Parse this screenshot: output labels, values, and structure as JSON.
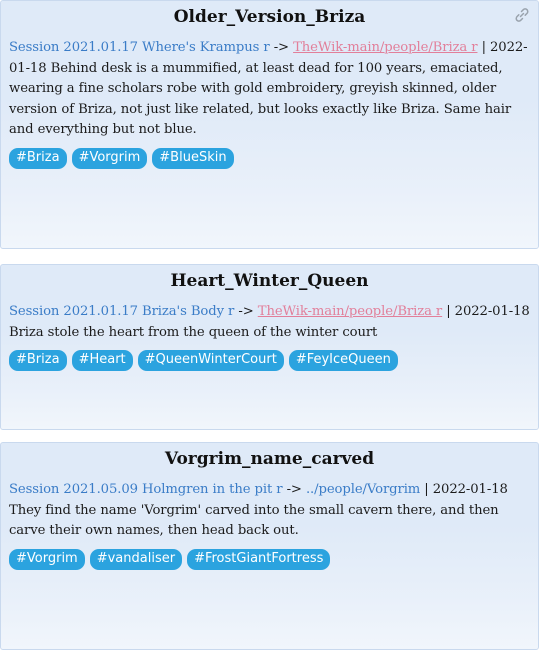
{
  "cards": [
    {
      "title": "Older_Version_Briza",
      "session_link": "Session 2021.01.17 Where's Krampus r",
      "arrow": "->",
      "target_link": "TheWik-main/people/Briza r",
      "text": " | 2022-01-18 Behind desk is a mummified, at least dead for 100 years, emaciated, wearing a fine scholars robe with gold embroidery, greyish skinned, older version of Briza, not just like related, but looks exactly like Briza. Same hair and everything but not blue.",
      "tags": [
        "#Briza",
        "#Vorgrim",
        "#BlueSkin"
      ],
      "link_icon": "link-icon"
    },
    {
      "title": "Heart_Winter_Queen",
      "session_link": "Session 2021.01.17 Briza's Body r",
      "arrow": "->",
      "target_link": "TheWik-main/people/Briza r",
      "text": " | 2022-01-18 Briza stole the heart from the queen of the winter court",
      "tags": [
        "#Briza",
        "#Heart",
        "#QueenWinterCourt",
        "#FeyIceQueen"
      ]
    },
    {
      "title": "Vorgrim_name_carved",
      "session_link": "Session 2021.05.09 Holmgren in the pit r",
      "arrow": "->",
      "target_link": "../people/Vorgrim",
      "text": " | 2022-01-18 They find the name 'Vorgrim' carved into the small cavern there, and then carve their own names, then head back out.",
      "tags": [
        "#Vorgrim",
        "#vandaliser",
        "#FrostGiantFortress"
      ]
    }
  ],
  "colors": {
    "card_bg": "#dfeaf8",
    "session_link": "#3a7cc7",
    "wiki_link": "#e27f9a",
    "tag_bg": "#2ba3df",
    "tag_text": "#ffffff"
  }
}
